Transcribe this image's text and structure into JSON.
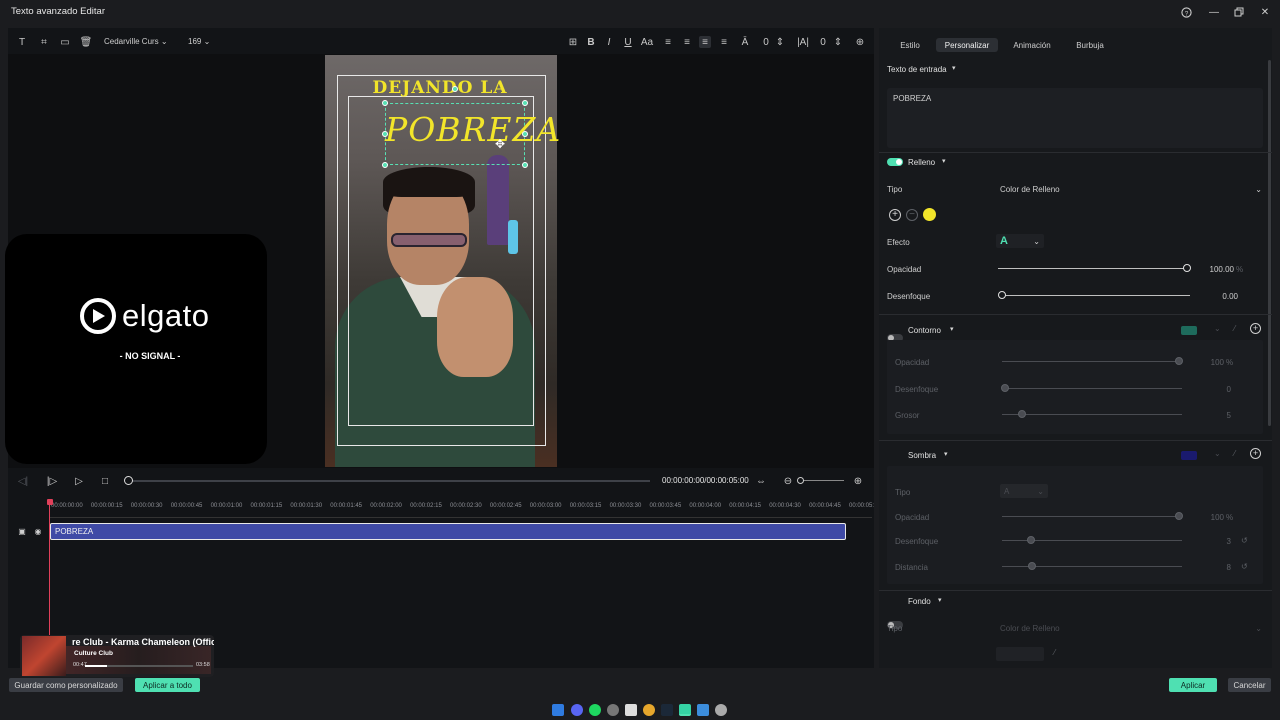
{
  "window": {
    "title": "Texto avanzado Editar",
    "help_icon": "help-icon",
    "minimize_icon": "minimize-icon",
    "maximize_icon": "maximize-icon",
    "close_icon": "close-icon"
  },
  "toolbar": {
    "font": "Cedarville Curs",
    "size": "169",
    "spacing_value": "0",
    "line_value": "0"
  },
  "preview": {
    "heading_text": "DEJANDO LA",
    "selected_text": "POBREZA",
    "no_signal_brand": "elgato",
    "no_signal_text": "- NO SIGNAL -",
    "text_color": "#f2e52a"
  },
  "playback": {
    "timecode": "00:00:00:00/00:00:05:00"
  },
  "timeline": {
    "ticks": [
      "00:00:00:00",
      "00:00:00:15",
      "00:00:00:30",
      "00:00:00:45",
      "00:00:01:00",
      "00:00:01:15",
      "00:00:01:30",
      "00:00:01:45",
      "00:00:02:00",
      "00:00:02:15",
      "00:00:02:30",
      "00:00:02:45",
      "00:00:03:00",
      "00:00:03:15",
      "00:00:03:30",
      "00:00:03:45",
      "00:00:04:00",
      "00:00:04:15",
      "00:00:04:30",
      "00:00:04:45",
      "00:00:05:"
    ],
    "clip_label": "POBREZA"
  },
  "media_widget": {
    "title": "re Club - Karma Chameleon (Offici",
    "artist": "Culture Club",
    "elapsed": "00:47",
    "duration": "03:58",
    "progress": 0.2
  },
  "footer": {
    "save_custom": "Guardar como personalizado",
    "apply_all": "Aplicar a todo",
    "apply": "Aplicar",
    "cancel": "Cancelar"
  },
  "tabs": [
    "Estilo",
    "Personalizar",
    "Animación",
    "Burbuja"
  ],
  "active_tab": "Personalizar",
  "props": {
    "input_title": "Texto de entrada",
    "input_value": "POBREZA",
    "fill": {
      "title": "Relleno",
      "enabled": true,
      "type_label": "Tipo",
      "type_value": "Color de Relleno",
      "color": "#f2e52a",
      "effect_label": "Efecto",
      "opacity_label": "Opacidad",
      "opacity_value": "100.00",
      "opacity_unit": "%",
      "blur_label": "Desenfoque",
      "blur_value": "0.00"
    },
    "outline": {
      "title": "Contorno",
      "enabled": false,
      "color": "#1e6b5c",
      "opacity_label": "Opacidad",
      "opacity_value": "100",
      "opacity_unit": "%",
      "blur_label": "Desenfoque",
      "blur_value": "0",
      "thickness_label": "Grosor",
      "thickness_value": "5"
    },
    "shadow": {
      "title": "Sombra",
      "enabled": false,
      "color": "#1a1a6e",
      "type_label": "Tipo",
      "opacity_label": "Opacidad",
      "opacity_value": "100",
      "opacity_unit": "%",
      "blur_label": "Desenfoque",
      "blur_value": "3",
      "distance_label": "Distancia",
      "distance_value": "8"
    },
    "background": {
      "title": "Fondo",
      "enabled": false,
      "type_label": "Tipo",
      "type_value": "Color de Relleno"
    }
  },
  "accent": "#4fe0b2"
}
